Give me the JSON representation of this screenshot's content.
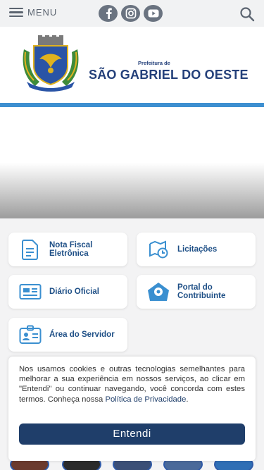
{
  "topbar": {
    "menu_label": "MENU",
    "social": [
      "facebook-icon",
      "instagram-icon",
      "youtube-icon"
    ],
    "search_icon": "search-icon"
  },
  "brand": {
    "prefix": "Prefeitura de",
    "name": "SÃO GABRIEL DO OESTE",
    "color": "#24407a",
    "accent_line": "#3d8fd0"
  },
  "services": [
    {
      "label": "Nota Fiscal\nEletrônica",
      "icon": "document-icon"
    },
    {
      "label": "Licitações",
      "icon": "map-clock-icon"
    },
    {
      "label": "Diário Oficial",
      "icon": "newspaper-icon"
    },
    {
      "label": "Portal do\nContribuinte",
      "icon": "location-pin-icon"
    },
    {
      "label": "Área do Servidor",
      "icon": "id-badge-icon"
    }
  ],
  "cookie": {
    "text": "Nos usamos cookies e outras tecnologias semelhantes para melhorar a sua experiência em nossos serviços, ao clicar em \"Entendi\" ou continuar navegando, você concorda com estes termos. Conheça nossa ",
    "link": "Política de Privacidade",
    "after_link": ".",
    "button": "Entendi",
    "button_color": "#1f3e6a"
  }
}
